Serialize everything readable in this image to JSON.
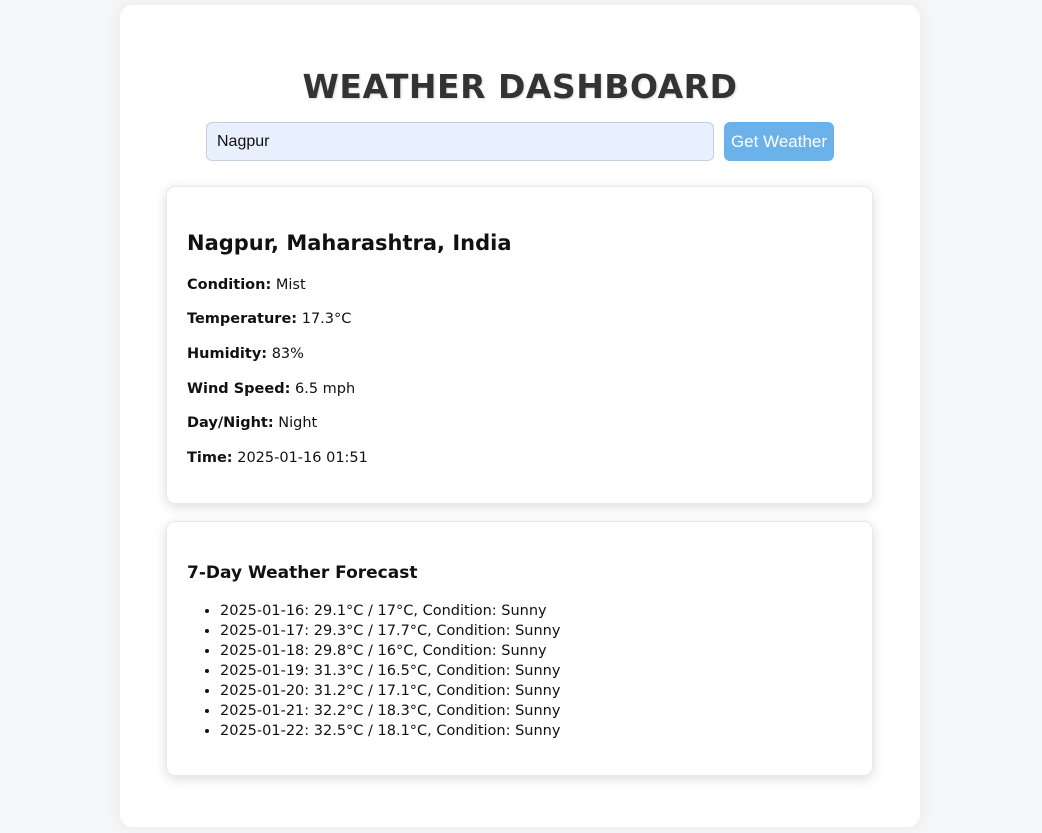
{
  "header": {
    "title": "WEATHER DASHBOARD"
  },
  "search": {
    "value": "Nagpur",
    "button_label": "Get Weather"
  },
  "current": {
    "location": "Nagpur, Maharashtra, India",
    "details": [
      {
        "label": "Condition:",
        "value": "Mist"
      },
      {
        "label": "Temperature:",
        "value": "17.3°C"
      },
      {
        "label": "Humidity:",
        "value": "83%"
      },
      {
        "label": "Wind Speed:",
        "value": "6.5 mph"
      },
      {
        "label": "Day/Night:",
        "value": "Night"
      },
      {
        "label": "Time:",
        "value": "2025-01-16 01:51"
      }
    ]
  },
  "forecast": {
    "title": "7-Day Weather Forecast",
    "items": [
      "2025-01-16: 29.1°C / 17°C, Condition: Sunny",
      "2025-01-17: 29.3°C / 17.7°C, Condition: Sunny",
      "2025-01-18: 29.8°C / 16°C, Condition: Sunny",
      "2025-01-19: 31.3°C / 16.5°C, Condition: Sunny",
      "2025-01-20: 31.2°C / 17.1°C, Condition: Sunny",
      "2025-01-21: 32.2°C / 18.3°C, Condition: Sunny",
      "2025-01-22: 32.5°C / 18.1°C, Condition: Sunny"
    ]
  },
  "colors": {
    "button": "#6bb2ea",
    "input_background": "#e8f0fe",
    "title": "#333333"
  }
}
